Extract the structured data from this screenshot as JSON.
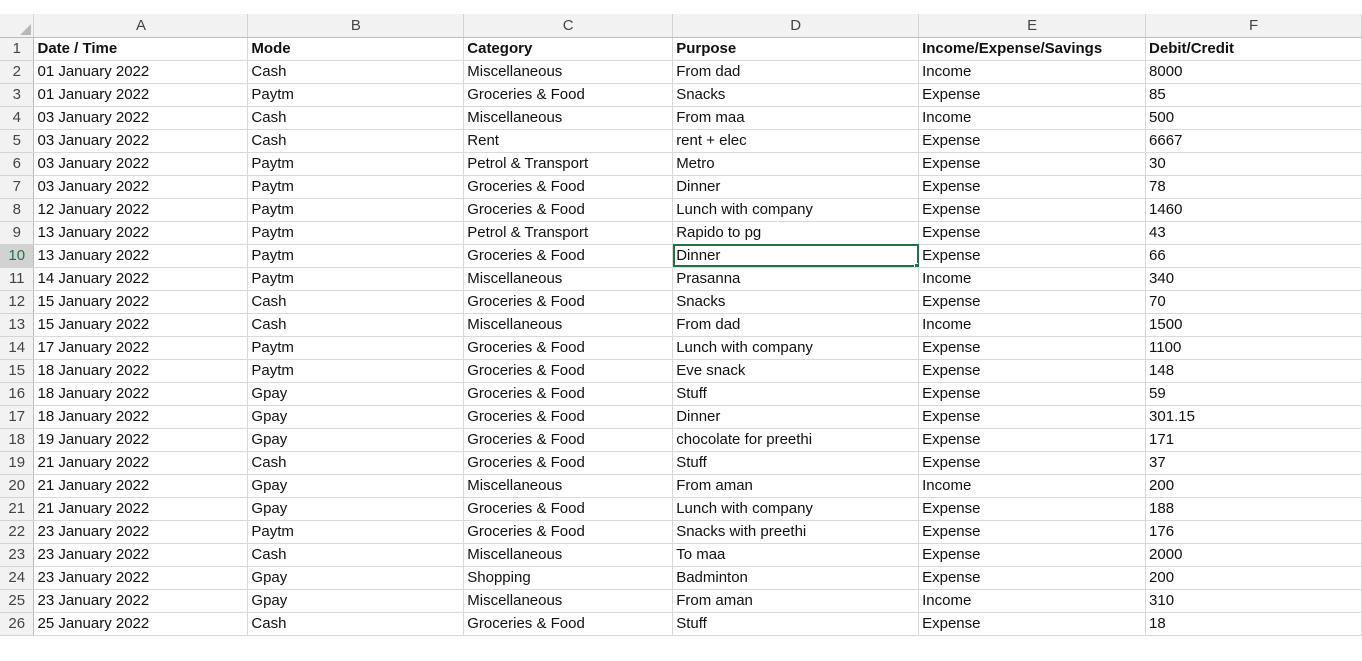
{
  "columns": [
    "A",
    "B",
    "C",
    "D",
    "E",
    "F"
  ],
  "active_column": 3,
  "active_row_index": 8,
  "header": {
    "row_number": "1",
    "cells": [
      "Date / Time",
      "Mode",
      "Category",
      "Purpose",
      "Income/Expense/Savings",
      "Debit/Credit"
    ]
  },
  "rows": [
    {
      "n": "2",
      "cells": [
        "01 January 2022",
        "Cash",
        "Miscellaneous",
        "From dad",
        "Income",
        "8000"
      ]
    },
    {
      "n": "3",
      "cells": [
        "01 January 2022",
        "Paytm",
        "Groceries & Food",
        "Snacks",
        "Expense",
        "85"
      ]
    },
    {
      "n": "4",
      "cells": [
        "03 January 2022",
        "Cash",
        "Miscellaneous",
        "From maa",
        "Income",
        "500"
      ]
    },
    {
      "n": "5",
      "cells": [
        "03 January 2022",
        "Cash",
        "Rent",
        "rent + elec",
        "Expense",
        "6667"
      ]
    },
    {
      "n": "6",
      "cells": [
        "03 January 2022",
        "Paytm",
        "Petrol & Transport",
        "Metro",
        "Expense",
        "30"
      ]
    },
    {
      "n": "7",
      "cells": [
        "03 January 2022",
        "Paytm",
        "Groceries & Food",
        "Dinner",
        "Expense",
        "78"
      ]
    },
    {
      "n": "8",
      "cells": [
        "12 January 2022",
        "Paytm",
        "Groceries & Food",
        "Lunch with company",
        "Expense",
        "1460"
      ]
    },
    {
      "n": "9",
      "cells": [
        "13 January 2022",
        "Paytm",
        "Petrol & Transport",
        "Rapido to pg",
        "Expense",
        "43"
      ]
    },
    {
      "n": "10",
      "cells": [
        "13 January 2022",
        "Paytm",
        "Groceries & Food",
        "Dinner",
        "Expense",
        "66"
      ]
    },
    {
      "n": "11",
      "cells": [
        "14 January 2022",
        "Paytm",
        "Miscellaneous",
        "Prasanna",
        "Income",
        "340"
      ]
    },
    {
      "n": "12",
      "cells": [
        "15 January 2022",
        "Cash",
        "Groceries & Food",
        "Snacks",
        "Expense",
        "70"
      ]
    },
    {
      "n": "13",
      "cells": [
        "15 January 2022",
        "Cash",
        "Miscellaneous",
        "From dad",
        "Income",
        "1500"
      ]
    },
    {
      "n": "14",
      "cells": [
        "17 January 2022",
        "Paytm",
        "Groceries & Food",
        "Lunch with company",
        "Expense",
        "1100"
      ]
    },
    {
      "n": "15",
      "cells": [
        "18 January 2022",
        "Paytm",
        "Groceries & Food",
        "Eve snack",
        "Expense",
        "148"
      ]
    },
    {
      "n": "16",
      "cells": [
        "18 January 2022",
        "Gpay",
        "Groceries & Food",
        "Stuff",
        "Expense",
        "59"
      ]
    },
    {
      "n": "17",
      "cells": [
        "18 January 2022",
        "Gpay",
        "Groceries & Food",
        "Dinner",
        "Expense",
        "301.15"
      ]
    },
    {
      "n": "18",
      "cells": [
        "19 January 2022",
        "Gpay",
        "Groceries & Food",
        "chocolate for preethi",
        "Expense",
        "171"
      ]
    },
    {
      "n": "19",
      "cells": [
        "21 January 2022",
        "Cash",
        "Groceries & Food",
        "Stuff",
        "Expense",
        "37"
      ]
    },
    {
      "n": "20",
      "cells": [
        "21 January 2022",
        "Gpay",
        "Miscellaneous",
        "From aman",
        "Income",
        "200"
      ]
    },
    {
      "n": "21",
      "cells": [
        "21 January 2022",
        "Gpay",
        "Groceries & Food",
        "Lunch with company",
        "Expense",
        "188"
      ]
    },
    {
      "n": "22",
      "cells": [
        "23 January 2022",
        "Paytm",
        "Groceries & Food",
        "Snacks with preethi",
        "Expense",
        "176"
      ]
    },
    {
      "n": "23",
      "cells": [
        "23 January 2022",
        "Cash",
        "Miscellaneous",
        "To maa",
        "Expense",
        "2000"
      ]
    },
    {
      "n": "24",
      "cells": [
        "23 January 2022",
        "Gpay",
        "Shopping",
        "Badminton",
        "Expense",
        "200"
      ]
    },
    {
      "n": "25",
      "cells": [
        "23 January 2022",
        "Gpay",
        "Miscellaneous",
        "From aman",
        "Income",
        "310"
      ]
    },
    {
      "n": "26",
      "cells": [
        "25 January 2022",
        "Cash",
        "Groceries & Food",
        "Stuff",
        "Expense",
        "18"
      ]
    }
  ]
}
